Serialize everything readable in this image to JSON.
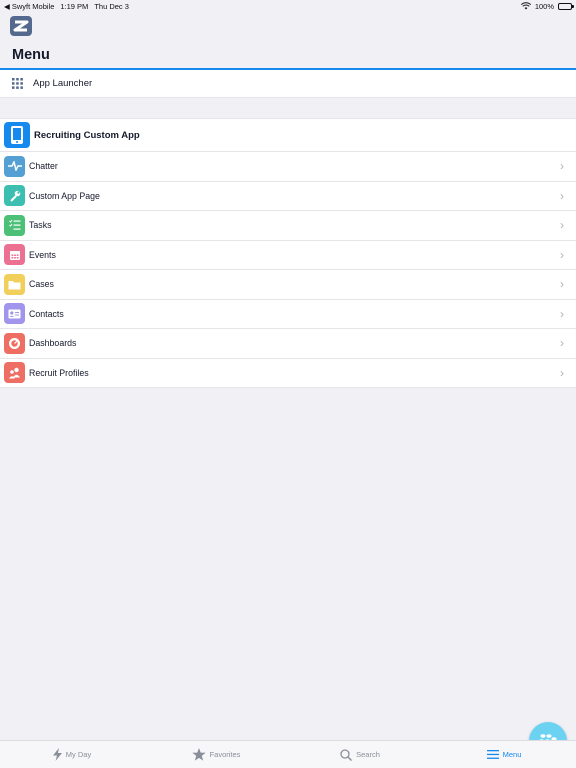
{
  "status_bar": {
    "carrier": "◀ Swyft Mobile",
    "time": "1:19 PM",
    "date": "Thu Dec 3",
    "battery": "100%"
  },
  "header": {
    "title": "Menu"
  },
  "launcher": {
    "label": "App Launcher"
  },
  "app": {
    "title": "Recruiting Custom App",
    "items": [
      {
        "label": "Chatter",
        "icon": "chatter-icon",
        "color": "#54a0d4"
      },
      {
        "label": "Custom App Page",
        "icon": "wrench-icon",
        "color": "#3cbfb0"
      },
      {
        "label": "Tasks",
        "icon": "tasks-icon",
        "color": "#4bc076"
      },
      {
        "label": "Events",
        "icon": "calendar-icon",
        "color": "#eb7092"
      },
      {
        "label": "Cases",
        "icon": "folder-icon",
        "color": "#f2cf5b"
      },
      {
        "label": "Contacts",
        "icon": "contact-card-icon",
        "color": "#a094ed"
      },
      {
        "label": "Dashboards",
        "icon": "dashboard-icon",
        "color": "#ef6e64"
      },
      {
        "label": "Recruit Profiles",
        "icon": "people-icon",
        "color": "#ef6e64"
      }
    ]
  },
  "tabs": [
    {
      "label": "My Day",
      "icon": "bolt-icon",
      "active": false
    },
    {
      "label": "Favorites",
      "icon": "star-icon",
      "active": false
    },
    {
      "label": "Search",
      "icon": "search-icon",
      "active": false
    },
    {
      "label": "Menu",
      "icon": "menu-icon",
      "active": true
    }
  ],
  "colors": {
    "accent": "#1589ee",
    "background": "#f0f0f5",
    "fab": "#6bd2f2"
  }
}
